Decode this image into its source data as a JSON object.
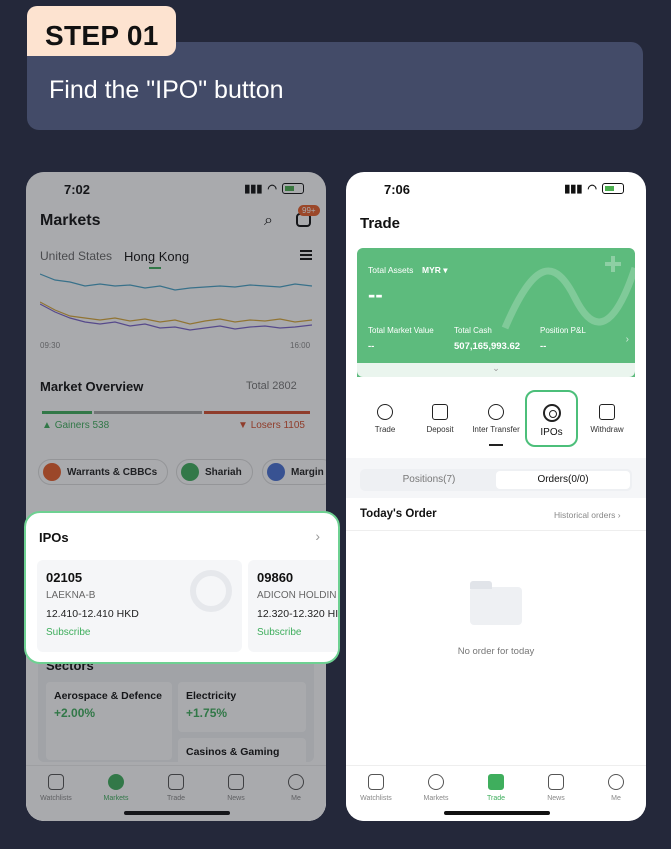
{
  "step": {
    "badge": "STEP 01",
    "title": "Find the \"IPO\" button"
  },
  "left_phone": {
    "time": "7:02",
    "title": "Markets",
    "notification_count": "99+",
    "tabs": [
      "United States",
      "Hong Kong"
    ],
    "active_tab": "Hong Kong",
    "chart": {
      "start_label": "09:30",
      "end_label": "16:00",
      "series_colors": [
        "#4aa3c7",
        "#d9a93b",
        "#7a63c9"
      ]
    },
    "market_overview": {
      "title": "Market Overview",
      "total": "Total 2802",
      "gainers": "Gainers 538",
      "losers": "Losers 1105"
    },
    "pills": [
      "Warrants & CBBCs",
      "Shariah",
      "Margin"
    ],
    "ipos": {
      "title": "IPOs",
      "items": [
        {
          "code": "02105",
          "name": "LAEKNA-B",
          "price": "12.410-12.410 HKD",
          "action": "Subscribe"
        },
        {
          "code": "09860",
          "name": "ADICON HOLDIN",
          "price": "12.320-12.320 HI",
          "action": "Subscribe"
        }
      ]
    },
    "sectors": {
      "title": "Sectors",
      "items": [
        {
          "name": "Aerospace & Defence",
          "change": "+2.00%"
        },
        {
          "name": "Electricity",
          "change": "+1.75%"
        },
        {
          "name": "Casinos & Gaming",
          "change": ""
        }
      ]
    },
    "tabbar": [
      "Watchlists",
      "Markets",
      "Trade",
      "News",
      "Me"
    ],
    "tabbar_active": "Markets"
  },
  "right_phone": {
    "time": "7:06",
    "title": "Trade",
    "assets": {
      "label": "Total Assets",
      "currency": "MYR",
      "value": "--",
      "market_value_label": "Total Market Value",
      "market_value": "--",
      "cash_label": "Total Cash",
      "cash": "507,165,993.62",
      "pnl_label": "Position P&L",
      "pnl": "--"
    },
    "actions": [
      "Trade",
      "Deposit",
      "Inter Transfer",
      "IPOs",
      "Withdraw"
    ],
    "segments": [
      "Positions(7)",
      "Orders(0/0)"
    ],
    "active_segment": "Orders(0/0)",
    "todays_order": "Today's Order",
    "historical": "Historical orders",
    "empty_text": "No order for today",
    "tabbar": [
      "Watchlists",
      "Markets",
      "Trade",
      "News",
      "Me"
    ],
    "tabbar_active": "Trade"
  },
  "colors": {
    "background": "#24283a",
    "banner": "#434b68",
    "badge": "#fde3d0",
    "accent": "#3fae5d",
    "loss": "#d6502f"
  }
}
